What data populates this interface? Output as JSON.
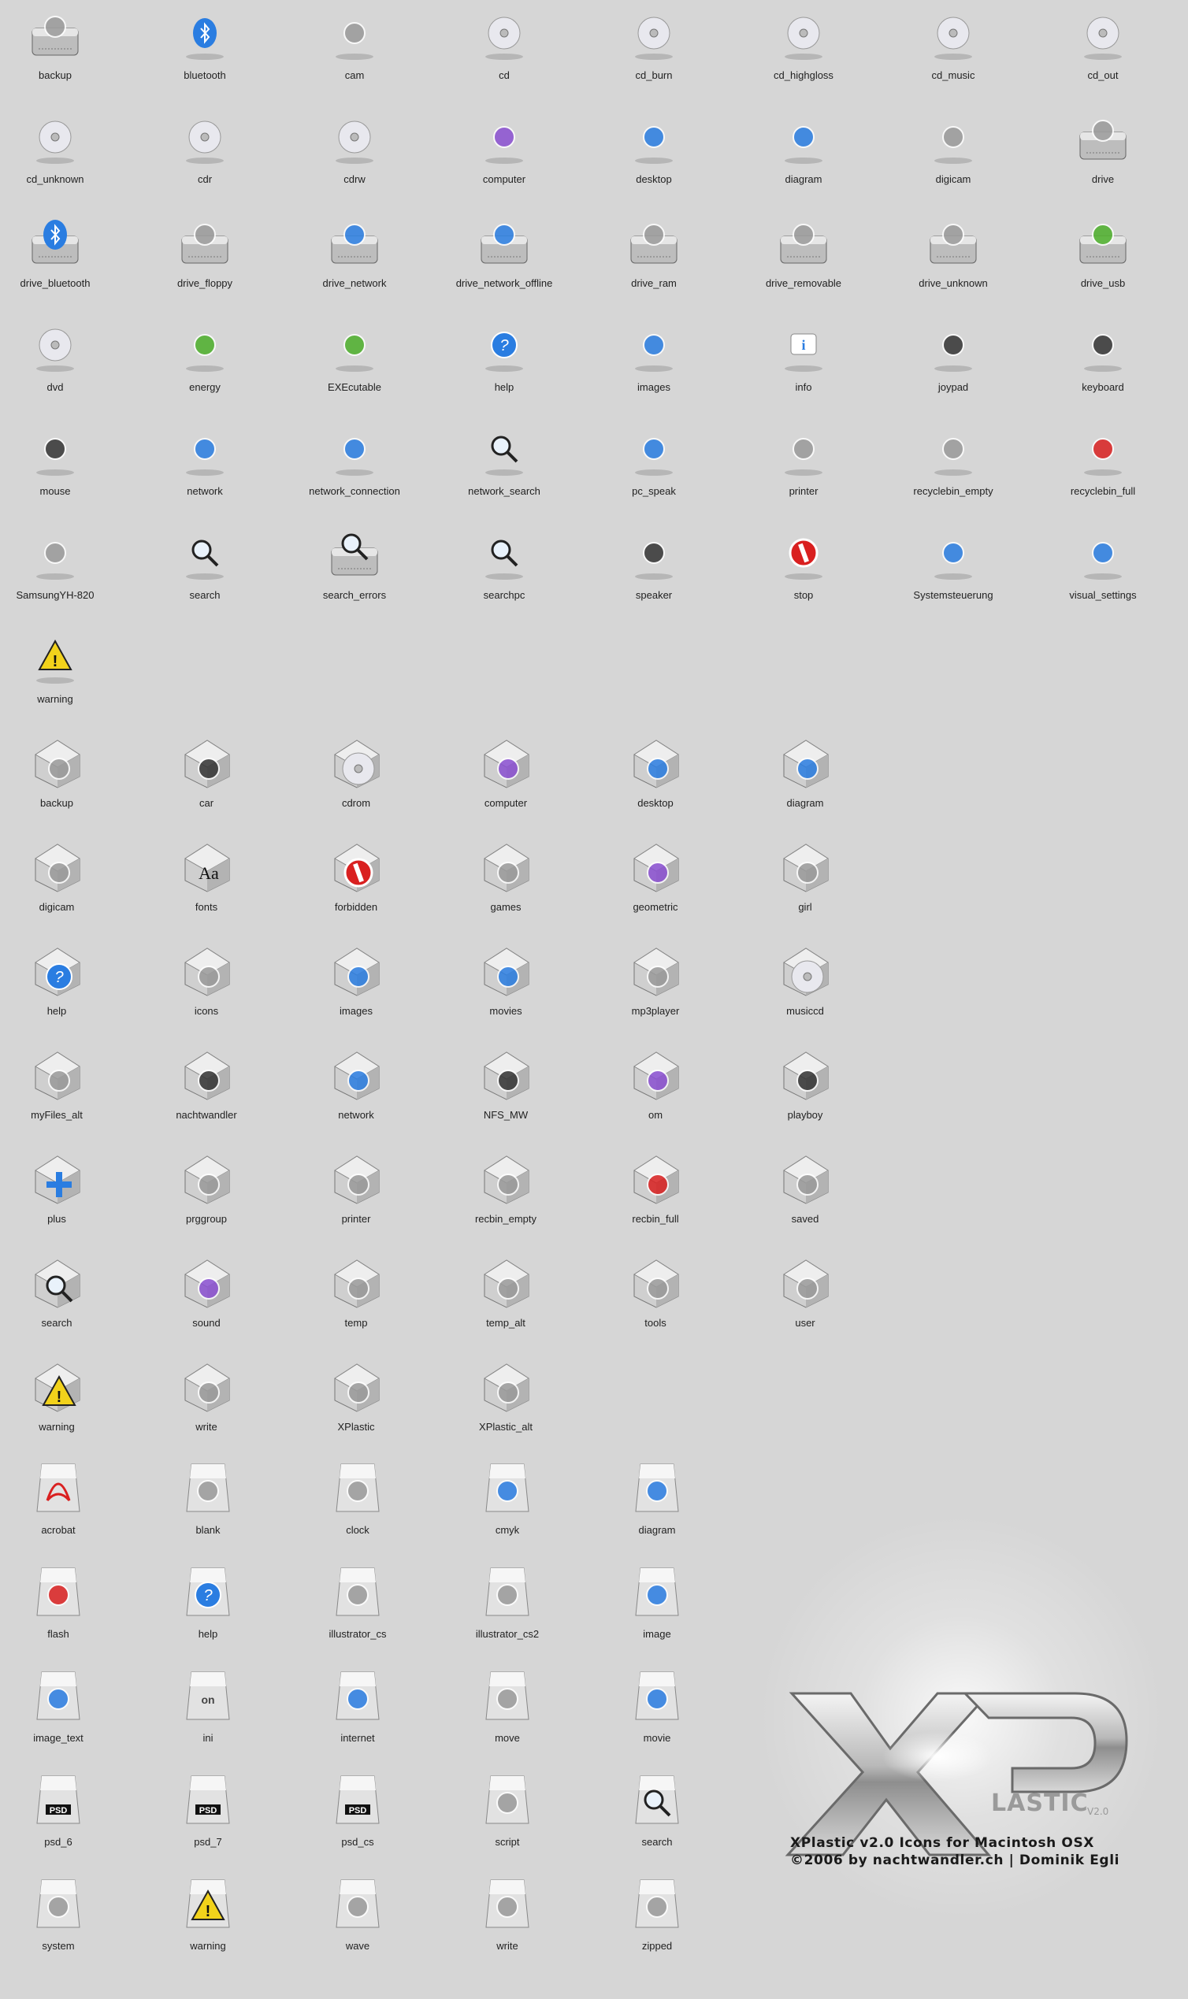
{
  "devices": [
    "backup",
    "bluetooth",
    "cam",
    "cd",
    "cd_burn",
    "cd_highgloss",
    "cd_music",
    "cd_out",
    "cd_unknown",
    "cdr",
    "cdrw",
    "computer",
    "desktop",
    "diagram",
    "digicam",
    "drive",
    "drive_bluetooth",
    "drive_floppy",
    "drive_network",
    "drive_network_offline",
    "drive_ram",
    "drive_removable",
    "drive_unknown",
    "drive_usb",
    "dvd",
    "energy",
    "EXEcutable",
    "help",
    "images",
    "info",
    "joypad",
    "keyboard",
    "mouse",
    "network",
    "network_connection",
    "network_search",
    "pc_speak",
    "printer",
    "recyclebin_empty",
    "recyclebin_full",
    "SamsungYH-820",
    "search",
    "search_errors",
    "searchpc",
    "speaker",
    "stop",
    "Systemsteuerung",
    "visual_settings",
    "warning"
  ],
  "folders": [
    "backup",
    "car",
    "cdrom",
    "computer",
    "desktop",
    "diagram",
    "digicam",
    "fonts",
    "forbidden",
    "games",
    "geometric",
    "girl",
    "help",
    "icons",
    "images",
    "movies",
    "mp3player",
    "musiccd",
    "myFiles_alt",
    "nachtwandler",
    "network",
    "NFS_MW",
    "om",
    "playboy",
    "plus",
    "prggroup",
    "printer",
    "recbin_empty",
    "recbin_full",
    "saved",
    "search",
    "sound",
    "temp",
    "temp_alt",
    "tools",
    "user",
    "warning",
    "write",
    "XPlastic",
    "XPlastic_alt"
  ],
  "files": [
    "acrobat",
    "blank",
    "clock",
    "cmyk",
    "diagram",
    "flash",
    "help",
    "illustrator_cs",
    "illustrator_cs2",
    "image",
    "image_text",
    "ini",
    "internet",
    "move",
    "movie",
    "psd_6",
    "psd_7",
    "psd_cs",
    "script",
    "search",
    "system",
    "warning",
    "wave",
    "write",
    "zipped"
  ],
  "brand": {
    "logo_suffix": "LASTIC",
    "version_mark": "V2.0",
    "line1": "XPlastic v2.0 Icons for Macintosh OSX",
    "line2": "©2006 by nachtwandler.ch | Dominik Egli"
  },
  "colors": {
    "background": "#d6d6d6",
    "label": "#222222",
    "metal": "#c9c9c9",
    "accent_blue": "#2a7de1",
    "accent_red": "#d92020",
    "accent_yellow": "#f2d21b"
  }
}
